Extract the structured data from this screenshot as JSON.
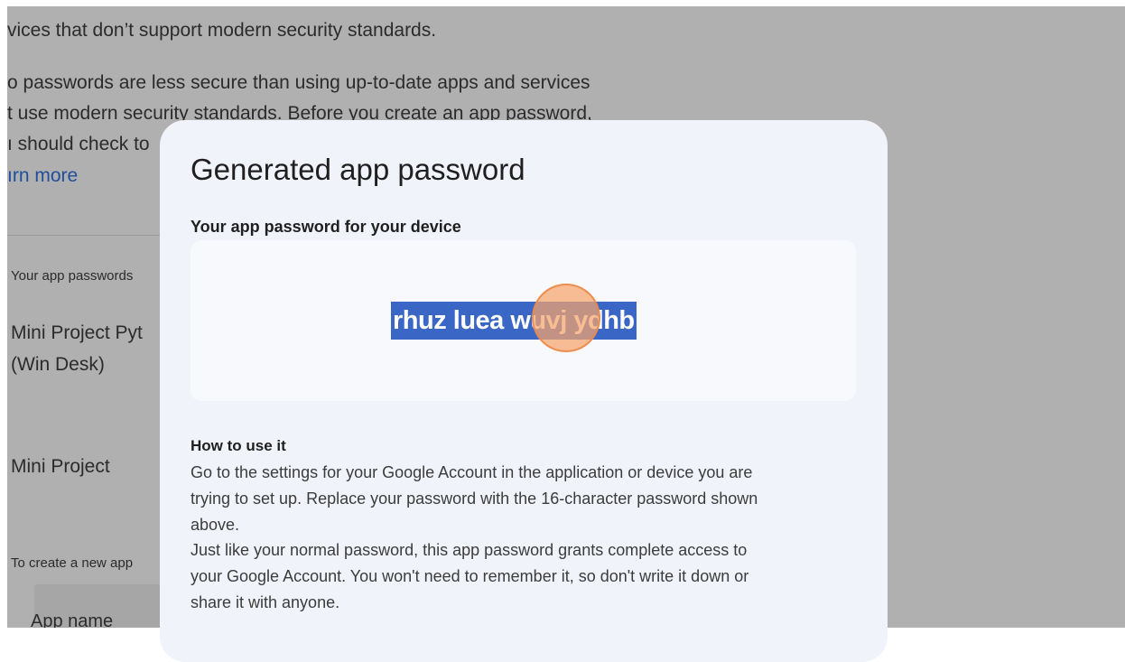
{
  "background": {
    "lines": [
      "vices that don’t support modern security standards.",
      "o passwords are less secure than using up-to-date apps and services",
      "t use modern security standards. Before you create an app password,",
      "ı should check to"
    ],
    "learn_more": "ırn more",
    "section_label": "Your app passwords",
    "items": [
      "Mini Project Pyt",
      "(Win Desk)",
      "Mini Project"
    ],
    "create_hint": "To create a new app",
    "app_name_label": "App name"
  },
  "dialog": {
    "title": "Generated app password",
    "subtitle": "Your app password for your device",
    "password": "rhuz luea wuvj ydhb",
    "how_to_title": "How to use it",
    "how_to_lines": [
      "Go to the settings for your Google Account in the application or device you are",
      "trying to set up. Replace your password with the 16-character password shown",
      "above.",
      "Just like your normal password, this app password grants complete access to",
      "your Google Account. You won't need to remember it, so don't write it down or",
      "share it with anyone."
    ]
  },
  "colors": {
    "overlay": "#b0b0b0",
    "dialog_bg": "#f0f3fa",
    "selection": "#3a66c6",
    "click_indicator": "#f7a36b"
  }
}
